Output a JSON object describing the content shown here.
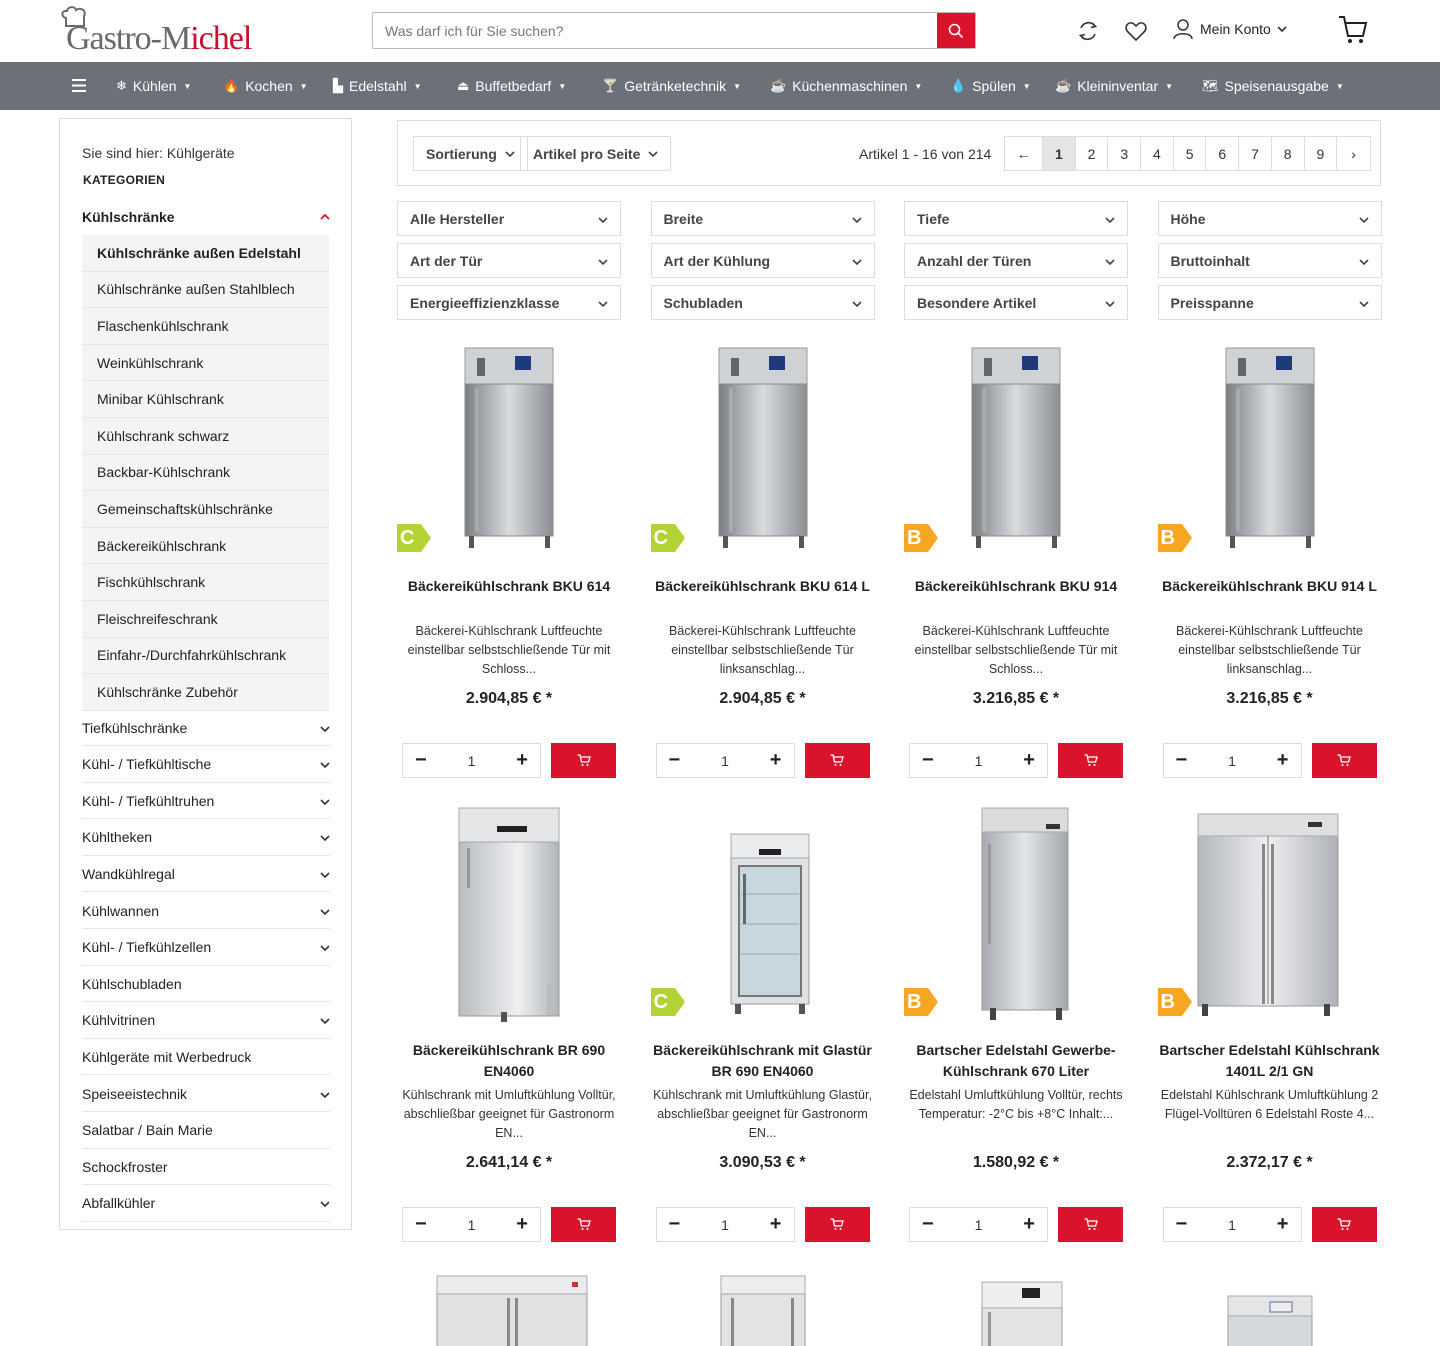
{
  "header": {
    "logo_part1": "Gastro-M",
    "logo_part2": "ichel",
    "search_placeholder": "Was darf ich für Sie suchen?",
    "account_label": "Mein Konto"
  },
  "nav": [
    {
      "label": "Kühlen",
      "icon": "❄"
    },
    {
      "label": "Kochen",
      "icon": "🔥"
    },
    {
      "label": "Edelstahl",
      "icon": "▙"
    },
    {
      "label": "Buffetbedarf",
      "icon": "⏏"
    },
    {
      "label": "Getränketechnik",
      "icon": "🍸"
    },
    {
      "label": "Küchenmaschinen",
      "icon": "☕"
    },
    {
      "label": "Spülen",
      "icon": "💧"
    },
    {
      "label": "Kleininventar",
      "icon": "☕"
    },
    {
      "label": "Speisenausgabe",
      "icon": "🗺"
    }
  ],
  "sidebar": {
    "breadcrumb": "Sie sind hier: Kühlgeräte",
    "heading": "KATEGORIEN",
    "active_category": "Kühlschränke",
    "subcategories": [
      "Kühlschränke außen Edelstahl",
      "Kühlschränke außen Stahlblech",
      "Flaschenkühlschrank",
      "Weinkühlschrank",
      "Minibar Kühlschrank",
      "Kühlschrank schwarz",
      "Backbar-Kühlschrank",
      "Gemeinschaftskühlschränke",
      "Bäckereikühlschrank",
      "Fischkühlschrank",
      "Fleischreifeschrank",
      "Einfahr-/Durchfahrkühlschrank",
      "Kühlschränke Zubehör"
    ],
    "categories": [
      {
        "label": "Tiefkühlschränke",
        "expandable": true
      },
      {
        "label": "Kühl- / Tiefkühltische",
        "expandable": true
      },
      {
        "label": "Kühl- / Tiefkühltruhen",
        "expandable": true
      },
      {
        "label": "Kühltheken",
        "expandable": true
      },
      {
        "label": "Wandkühlregal",
        "expandable": true
      },
      {
        "label": "Kühlwannen",
        "expandable": true
      },
      {
        "label": "Kühl- / Tiefkühlzellen",
        "expandable": true
      },
      {
        "label": "Kühlschubladen",
        "expandable": false
      },
      {
        "label": "Kühlvitrinen",
        "expandable": true
      },
      {
        "label": "Kühlgeräte mit Werbedruck",
        "expandable": false
      },
      {
        "label": "Speiseeistechnik",
        "expandable": true
      },
      {
        "label": "Salatbar / Bain Marie",
        "expandable": false
      },
      {
        "label": "Schockfroster",
        "expandable": false
      },
      {
        "label": "Abfallkühler",
        "expandable": true
      }
    ]
  },
  "toolbar": {
    "sort_label": "Sortierung",
    "per_page_label": "Artikel pro Seite",
    "article_count": "Artikel 1 - 16 von 214",
    "prev": "←",
    "next": "›",
    "pages": [
      "1",
      "2",
      "3",
      "4",
      "5",
      "6",
      "7",
      "8",
      "9"
    ]
  },
  "filters": [
    "Alle Hersteller",
    "Breite",
    "Tiefe",
    "Höhe",
    "Art der Tür",
    "Art der Kühlung",
    "Anzahl der Türen",
    "Bruttoinhalt",
    "Energieeffizienzklasse",
    "Schubladen",
    "Besondere Artikel",
    "Preisspanne"
  ],
  "products": [
    {
      "title": "Bäckereikühlschrank BKU 614",
      "desc": "Bäckerei-Kühlschrank Luftfeuchte einstellbar selbstschließende Tür mit Schloss...",
      "price": "2.904,85 € *",
      "energy": "C",
      "qty": "1",
      "style": "single-dark"
    },
    {
      "title": "Bäckereikühlschrank BKU 614 L",
      "desc": "Bäckerei-Kühlschrank Luftfeuchte einstellbar selbstschließende Tür linksanschlag...",
      "price": "2.904,85 € *",
      "energy": "C",
      "qty": "1",
      "style": "single-dark"
    },
    {
      "title": "Bäckereikühlschrank BKU 914",
      "desc": "Bäckerei-Kühlschrank Luftfeuchte einstellbar selbstschließende Tür mit Schloss...",
      "price": "3.216,85 € *",
      "energy": "B",
      "qty": "1",
      "style": "single-dark"
    },
    {
      "title": "Bäckereikühlschrank BKU 914 L",
      "desc": "Bäckerei-Kühlschrank Luftfeuchte einstellbar selbstschließende Tür linksanschlag...",
      "price": "3.216,85 € *",
      "energy": "B",
      "qty": "1",
      "style": "single-dark"
    },
    {
      "title": "Bäckereikühlschrank BR 690 EN4060",
      "desc": "Kühlschrank mit Umluftkühlung Volltür, abschließbar geeignet für Gastronorm EN...",
      "price": "2.641,14 € *",
      "energy": "",
      "qty": "1",
      "style": "single-light"
    },
    {
      "title": "Bäckereikühlschrank mit Glastür BR 690 EN4060",
      "desc": "Kühlschrank mit Umluftkühlung Glastür, abschließbar geeignet für Gastronorm EN...",
      "price": "3.090,53 € *",
      "energy": "C",
      "qty": "1",
      "style": "glass"
    },
    {
      "title": "Bartscher Edelstahl Gewerbe-Kühlschrank 670 Liter",
      "desc": "Edelstahl Umluftkühlung Volltür, rechts Temperatur: -2°C bis +8°C Inhalt:...",
      "price": "1.580,92 € *",
      "energy": "B",
      "qty": "1",
      "style": "single-tall"
    },
    {
      "title": "Bartscher Edelstahl Kühlschrank 1401L 2/1 GN",
      "desc": "Edelstahl Kühlschrank Umluftkühlung 2 Flügel-Volltüren 6 Edelstahl Roste 4...",
      "price": "2.372,17 € *",
      "energy": "B",
      "qty": "1",
      "style": "double"
    }
  ]
}
